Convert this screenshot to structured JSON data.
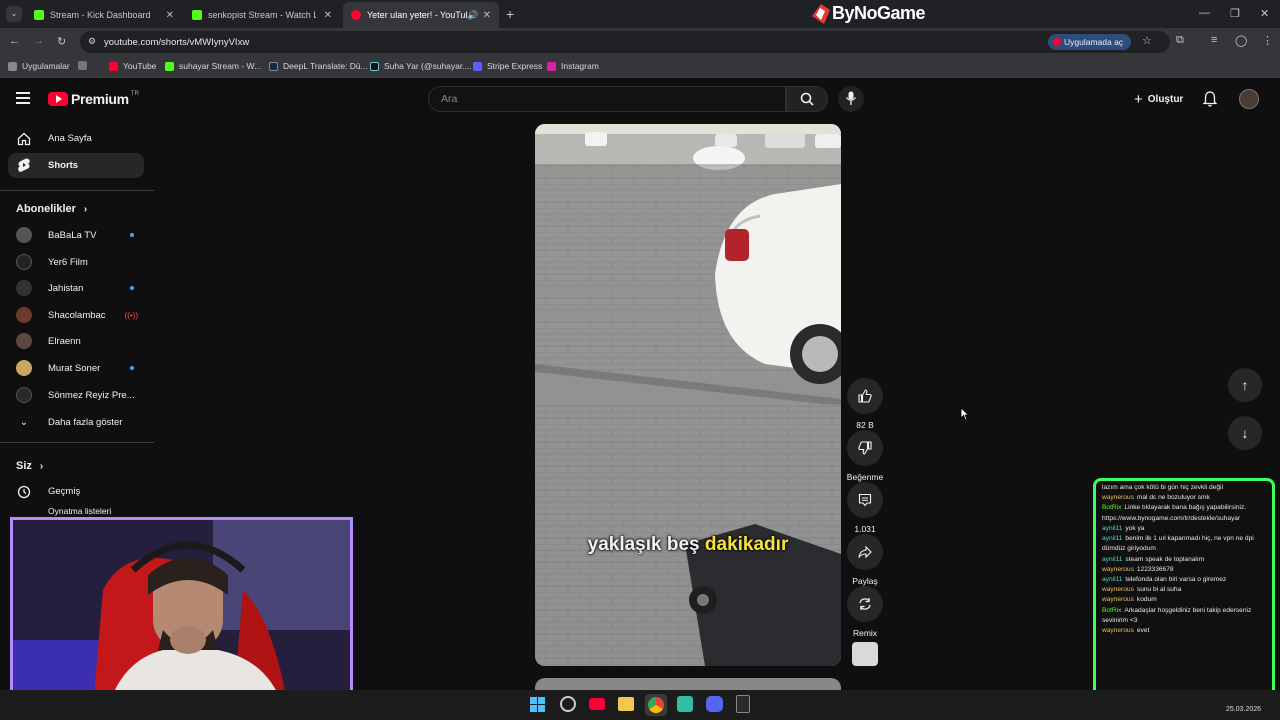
{
  "browser": {
    "tabs": [
      {
        "title": "Stream - Kick Dashboard",
        "color": "#53fc18"
      },
      {
        "title": "senkopist Stream - Watch Live o",
        "color": "#53fc18"
      },
      {
        "title": "Yeter ulan yeter! - YouTube",
        "color": "#ff0033"
      }
    ],
    "url": "youtube.com/shorts/vMWIynyVIxw",
    "open_app_label": "Uygulamada aç",
    "overlay_brand": "ByNoGame",
    "bookmarks": [
      {
        "label": "Uygulamalar",
        "icon": "apps-grid-icon"
      },
      {
        "label": "YouTube",
        "icon": "youtube-icon"
      },
      {
        "label": "suhayar Stream - W...",
        "icon": "kick-icon"
      },
      {
        "label": "DeepL Translate: Dü...",
        "icon": "deepl-icon"
      },
      {
        "label": "Suha Yar (@suhayar....",
        "icon": "tiktok-icon"
      },
      {
        "label": "Stripe Express",
        "icon": "stripe-icon"
      },
      {
        "label": "Instagram",
        "icon": "instagram-icon"
      }
    ]
  },
  "youtube": {
    "logo_text": "Premium",
    "region": "TR",
    "search_placeholder": "Ara",
    "create_label": "Oluştur"
  },
  "sidebar": {
    "main": [
      {
        "label": "Ana Sayfa"
      },
      {
        "label": "Shorts"
      }
    ],
    "subscriptions_title": "Abonelikler",
    "subscriptions": [
      {
        "label": "BaBaLa TV",
        "indicator": "dot",
        "avatar_color": "#555"
      },
      {
        "label": "Yer6 Film",
        "indicator": "",
        "avatar_color": "#222"
      },
      {
        "label": "Jahistan",
        "indicator": "dot",
        "avatar_color": "#333"
      },
      {
        "label": "Shacolambac",
        "indicator": "live",
        "avatar_color": "#6a3b2c"
      },
      {
        "label": "Elraenn",
        "indicator": "",
        "avatar_color": "#5a4a40"
      },
      {
        "label": "Murat Soner",
        "indicator": "dot",
        "avatar_color": "#c8a560"
      },
      {
        "label": "Sönmez Reyiz Pre...",
        "indicator": "",
        "avatar_color": "#2a2a2a"
      }
    ],
    "show_more": "Daha fazla göster",
    "you_title": "Siz",
    "history": "Geçmiş",
    "playlists_partial": "Oynatma listeleri"
  },
  "short": {
    "caption_plain": "yaklaşık beş ",
    "caption_highlight": "dakikadır",
    "actions": {
      "likes": "82 B",
      "dislike_label": "Beğenme",
      "comments": "1.031",
      "share_label": "Paylaş",
      "remix_label": "Remix"
    }
  },
  "chat": {
    "messages": [
      {
        "user": "",
        "text": "lazım ama çok kötü bi gün hiç zevkli değil",
        "color": "#e8e8e8"
      },
      {
        "user": "waynerous",
        "text": "mal dc ne bozuluyor smk",
        "color": "#e6c15a"
      },
      {
        "user": "BotRix",
        "text": "Linke tıklayarak bana bağış yapabilirsiniz. https://www.bynogame.com/tr/destekle/suhayar",
        "color": "#53fc18"
      },
      {
        "user": "aynil11",
        "text": "yok ya",
        "color": "#4fd6c8"
      },
      {
        "user": "aynil11",
        "text": "benim ilk 1 uıl kapanmadı hiç, ne vpn ne dpi dümdüz giriyodum",
        "color": "#4fd6c8"
      },
      {
        "user": "aynil11",
        "text": "steam speak de toplanalım",
        "color": "#4fd6c8"
      },
      {
        "user": "waynerous",
        "text": "1223336678",
        "color": "#e6c15a"
      },
      {
        "user": "aynil11",
        "text": "telefonda olan biri varsa o giremez",
        "color": "#4fd6c8"
      },
      {
        "user": "waynerous",
        "text": "sunu bi al suha",
        "color": "#e6c15a"
      },
      {
        "user": "waynerous",
        "text": "kodum",
        "color": "#e6c15a"
      },
      {
        "user": "BotRix",
        "text": "Arkadaşlar hoşgeldiniz beni takip ederseniz sevinirim <3",
        "color": "#53fc18"
      },
      {
        "user": "waynerous",
        "text": "evet",
        "color": "#e6c15a"
      }
    ]
  },
  "taskbar": {
    "date": "25.03.2026"
  }
}
